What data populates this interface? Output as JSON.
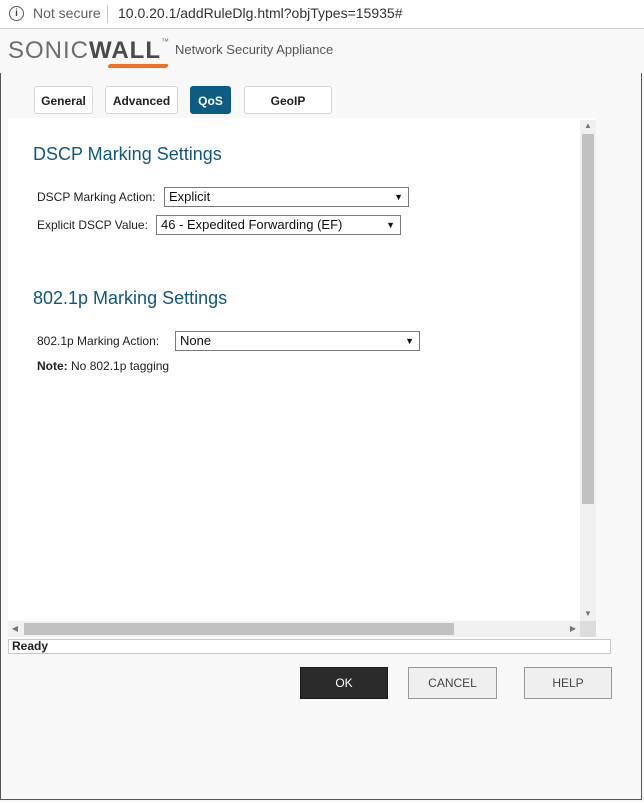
{
  "browser": {
    "security": "Not secure",
    "url": "10.0.20.1/addRuleDlg.html?objTypes=15935#"
  },
  "header": {
    "logo_prefix": "SONIC",
    "logo_bold": "WALL",
    "logo_tm": "™",
    "app_name": "Network Security Appliance"
  },
  "tabs": [
    {
      "label": "General"
    },
    {
      "label": "Advanced"
    },
    {
      "label": "QoS"
    },
    {
      "label": "GeoIP"
    }
  ],
  "dscp": {
    "heading": "DSCP Marking Settings",
    "action_label": "DSCP Marking Action:",
    "action_value": "Explicit",
    "value_label": "Explicit DSCP Value:",
    "value_value": "46 - Expedited Forwarding (EF)"
  },
  "dot1p": {
    "heading": "802.1p Marking Settings",
    "action_label": "802.1p Marking Action:",
    "action_value": "None",
    "note_label": "Note:",
    "note_text": "No 802.1p tagging"
  },
  "status": "Ready",
  "buttons": {
    "ok": "OK",
    "cancel": "CANCEL",
    "help": "HELP"
  },
  "colors": {
    "accent": "#0b5d86",
    "heading": "#11587d",
    "brand_orange": "#f36f21"
  }
}
